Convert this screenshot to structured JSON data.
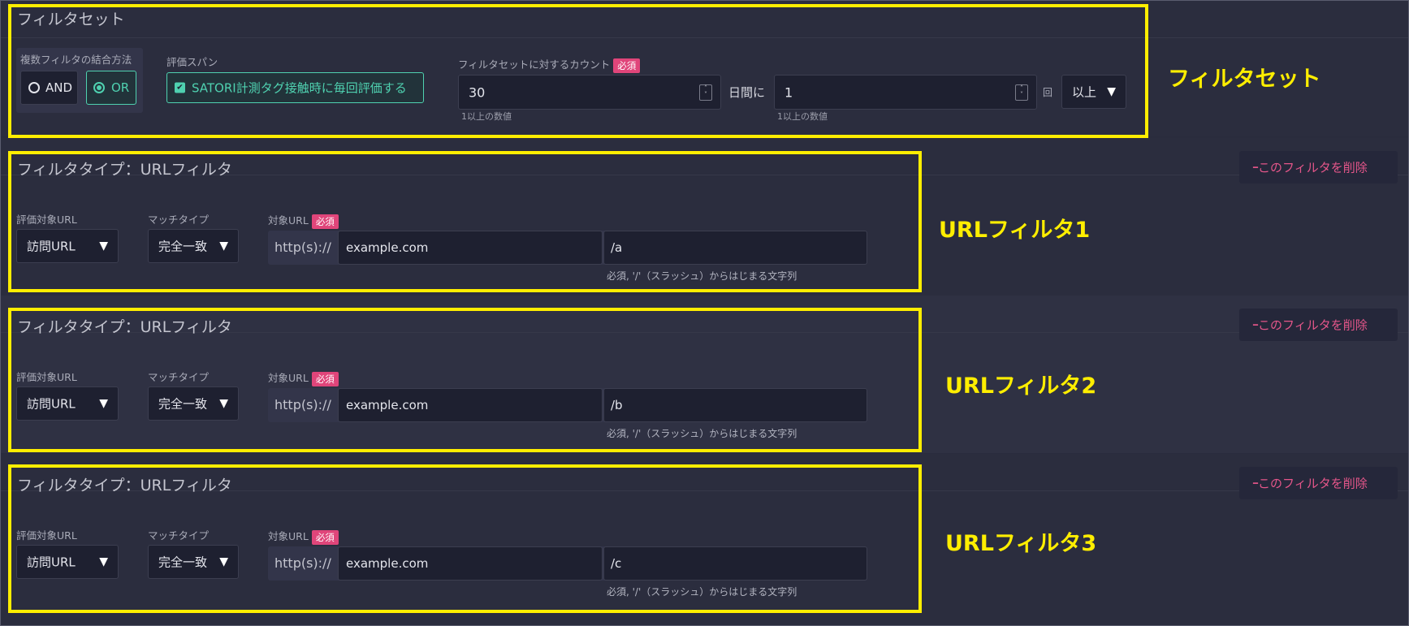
{
  "filter_set": {
    "title": "フィルタセット",
    "combine_label": "複数フィルタの結合方法",
    "and_label": "AND",
    "or_label": "OR",
    "eval_span_label": "評価スパン",
    "eval_span_checkbox": "SATORI計測タグ接触時に毎回評価する",
    "count_label": "フィルタセットに対するカウント",
    "required": "必須",
    "count_value": "30",
    "count_hint": "1以上の数値",
    "days_label": "日間に",
    "times_value": "1",
    "times_hint": "1以上の数値",
    "times_unit": "回",
    "comparison_value": "以上"
  },
  "filters": [
    {
      "title": "フィルタタイプ：URLフィルタ",
      "target_label": "評価対象URL",
      "target_value": "訪問URL",
      "match_label": "マッチタイプ",
      "match_value": "完全一致",
      "url_label": "対象URL",
      "required": "必須",
      "prefix": "http(s)://",
      "domain": "example.com",
      "path": "/a",
      "path_hint": "必須, '/'（スラッシュ）からはじまる文字列",
      "delete_label": "このフィルタを削除",
      "annotation": "URLフィルタ1"
    },
    {
      "title": "フィルタタイプ：URLフィルタ",
      "target_label": "評価対象URL",
      "target_value": "訪問URL",
      "match_label": "マッチタイプ",
      "match_value": "完全一致",
      "url_label": "対象URL",
      "required": "必須",
      "prefix": "http(s)://",
      "domain": "example.com",
      "path": "/b",
      "path_hint": "必須, '/'（スラッシュ）からはじまる文字列",
      "delete_label": "このフィルタを削除",
      "annotation": "URLフィルタ2"
    },
    {
      "title": "フィルタタイプ：URLフィルタ",
      "target_label": "評価対象URL",
      "target_value": "訪問URL",
      "match_label": "マッチタイプ",
      "match_value": "完全一致",
      "url_label": "対象URL",
      "required": "必須",
      "prefix": "http(s)://",
      "domain": "example.com",
      "path": "/c",
      "path_hint": "必須, '/'（スラッシュ）からはじまる文字列",
      "delete_label": "このフィルタを削除",
      "annotation": "URLフィルタ3"
    }
  ],
  "annotation_filter_set": "フィルタセット",
  "colors": {
    "highlight": "#ffee00",
    "accent_teal": "#4fd1b0",
    "required_pink": "#e0457a",
    "delete_pink": "#e5568a",
    "background": "#2a2c3d"
  },
  "icons": {
    "caret": "▼",
    "minus": "━",
    "check": "✔"
  }
}
